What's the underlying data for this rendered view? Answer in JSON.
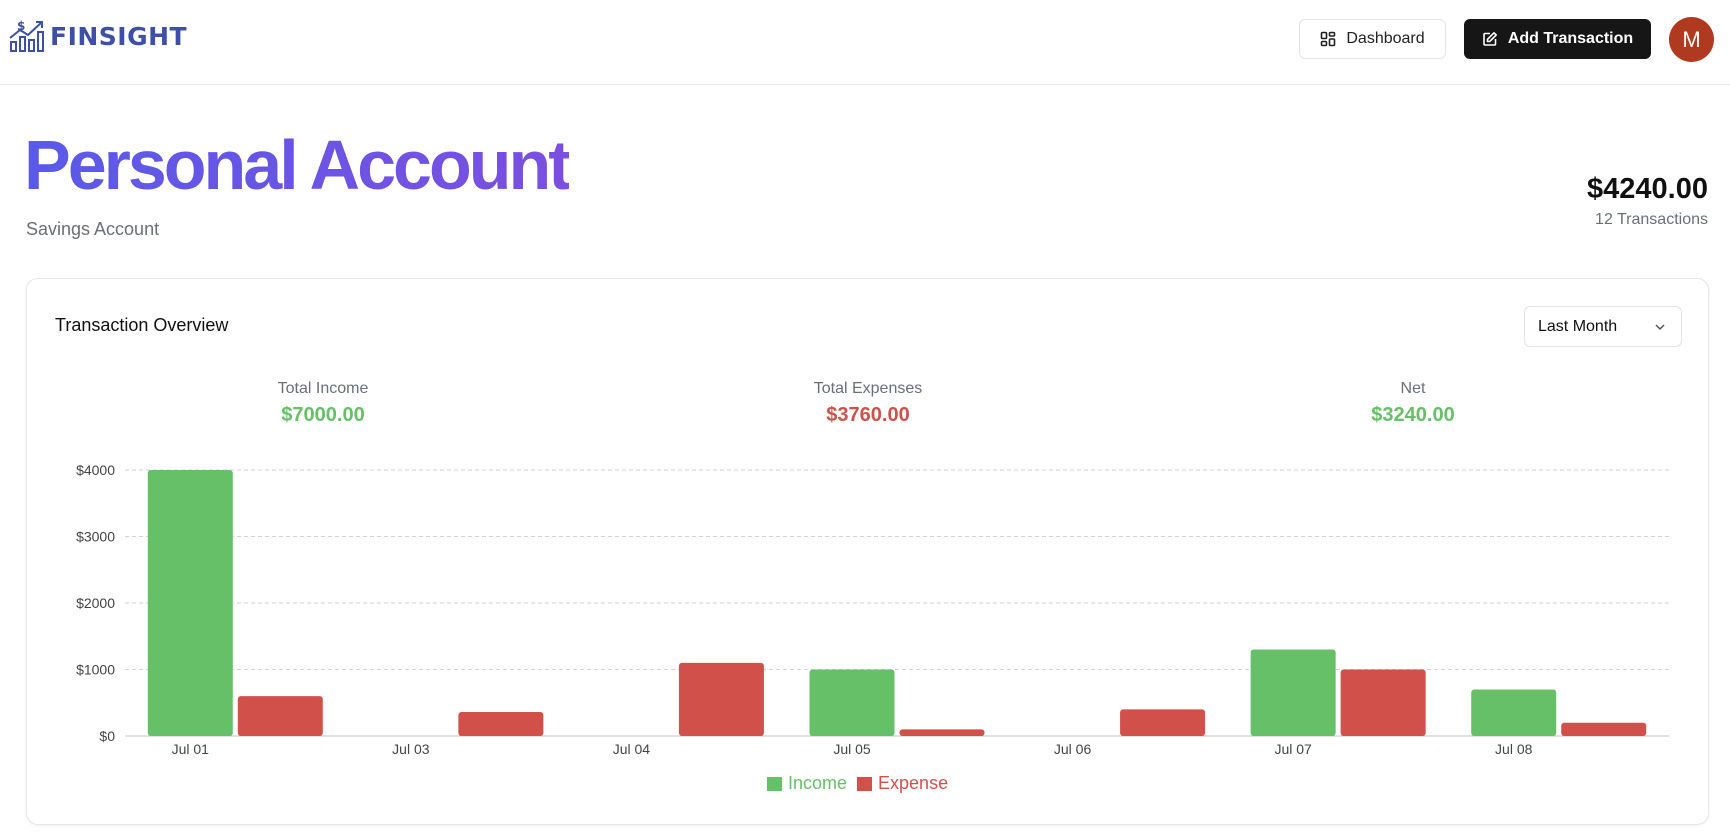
{
  "header": {
    "logo_text": "FINSIGHT",
    "dashboard_label": "Dashboard",
    "add_transaction_label": "Add Transaction",
    "avatar_initial": "M"
  },
  "account": {
    "name": "Personal Account",
    "type": "Savings Account",
    "balance": "$4240.00",
    "transactions_count": "12 Transactions"
  },
  "card": {
    "title": "Transaction Overview",
    "period_selected": "Last Month"
  },
  "stats": {
    "income": {
      "label": "Total Income",
      "value": "$7000.00"
    },
    "expenses": {
      "label": "Total Expenses",
      "value": "$3760.00"
    },
    "net": {
      "label": "Net",
      "value": "$3240.00"
    }
  },
  "colors": {
    "income": "#66c067",
    "expense": "#d1514a",
    "title_gradient_start": "#5a5ae8",
    "title_gradient_end": "#7b4fe0",
    "primary_button": "#161616",
    "avatar": "#b03a1f"
  },
  "chart_data": {
    "type": "bar",
    "categories": [
      "Jul 01",
      "Jul 03",
      "Jul 04",
      "Jul 05",
      "Jul 06",
      "Jul 07",
      "Jul 08"
    ],
    "series": [
      {
        "name": "Income",
        "values": [
          4000,
          0,
          0,
          1000,
          0,
          1300,
          700
        ]
      },
      {
        "name": "Expense",
        "values": [
          600,
          360,
          1100,
          100,
          400,
          1000,
          200
        ]
      }
    ],
    "yticks": [
      "$0",
      "$1000",
      "$2000",
      "$3000",
      "$4000"
    ],
    "ylim": [
      0,
      4000
    ],
    "grid": true,
    "legend": "bottom-center"
  }
}
